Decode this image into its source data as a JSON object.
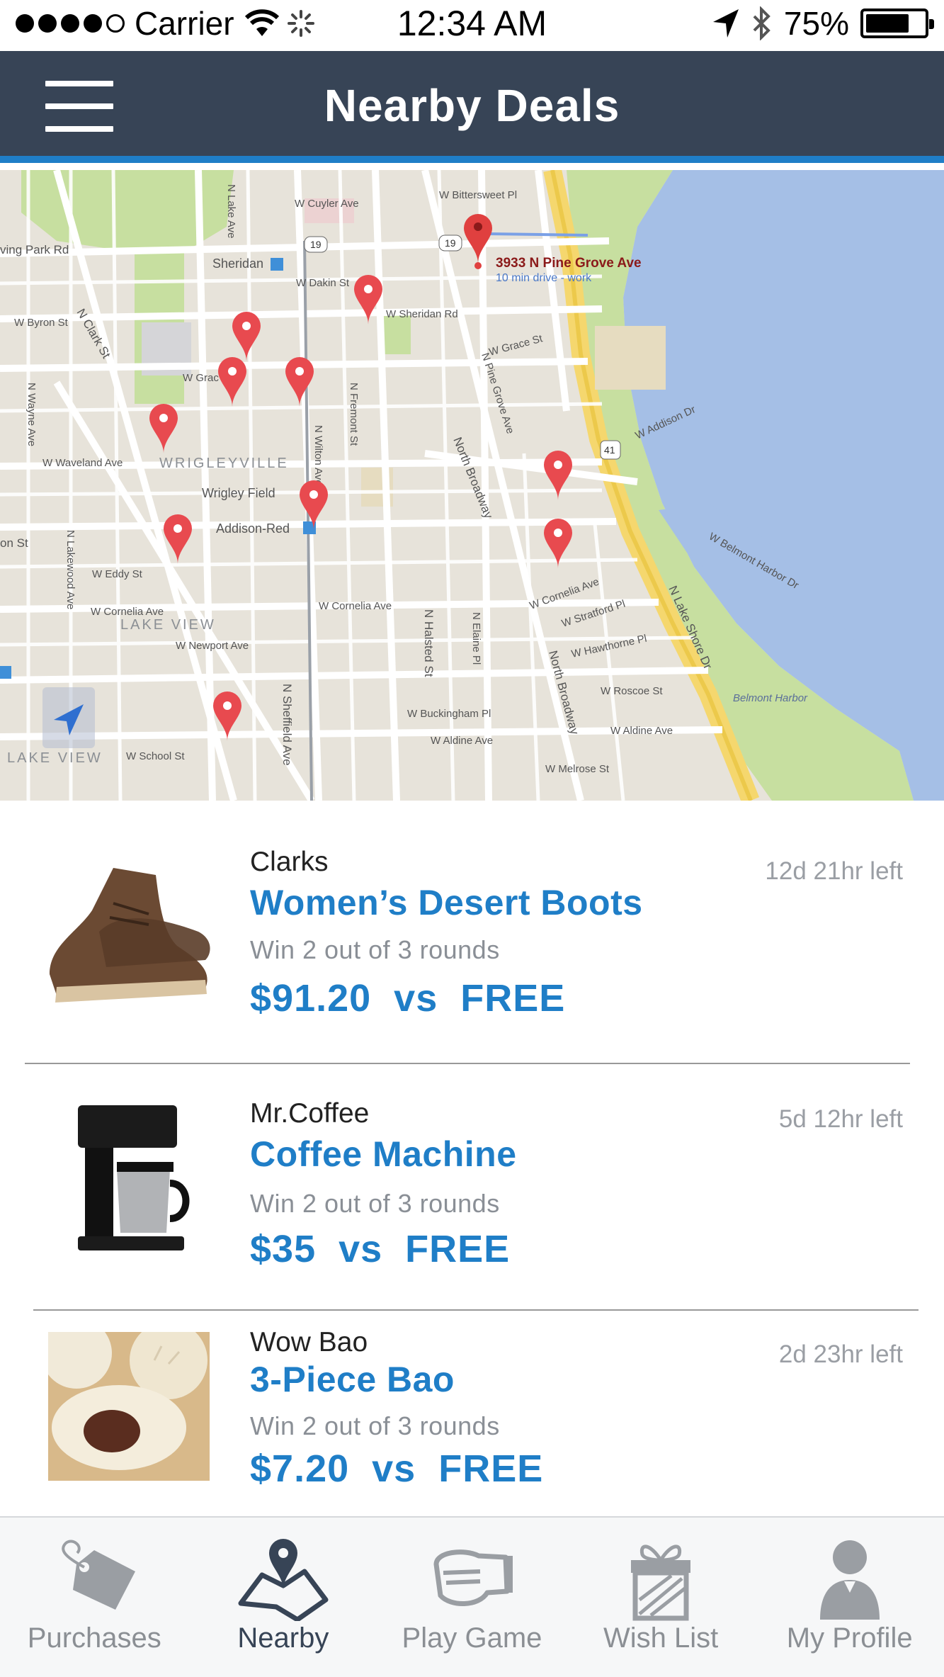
{
  "status_bar": {
    "carrier": "Carrier",
    "time": "12:34 AM",
    "battery": "75%",
    "battery_level": 0.75
  },
  "header": {
    "title": "Nearby Deals"
  },
  "map": {
    "location_label": "3933 N Pine Grove Ave",
    "location_sublabel": "10 min drive - work",
    "neighborhoods": [
      "WRIGLEYVILLE",
      "LAKE VIEW",
      "LAKE VIEW"
    ],
    "places": [
      "Sheridan",
      "Wrigley Field",
      "Addison-Red",
      "Belmont Harbor"
    ],
    "streets": [
      "W Cuyler Ave",
      "W Bittersweet Pl",
      "ving Park Rd",
      "W Dakin St",
      "W Sheridan Rd",
      "W Byron St",
      "N Clark St",
      "W Grace St",
      "N Wayne Ave",
      "W Waveland Ave",
      "N Fremont St",
      "N Wilton Ave",
      "North Broadway",
      "N Pine Grove Ave",
      "W Addison Dr",
      "W Eddy St",
      "N Lakewood Ave",
      "W Cornelia Ave",
      "W Newport Ave",
      "N Halsted St",
      "N Elaine Pl",
      "W Stratford Pl",
      "W Hawthorne Pl",
      "W Roscoe St",
      "W Buckingham Pl",
      "W Aldine Ave",
      "W Melrose St",
      "N Sheffield Ave",
      "W School St",
      "N Lake Shore Dr",
      "W Belmont Harbor Dr",
      "W Cornelia Ave",
      "W Aldine Ave",
      "on St",
      "W Gra",
      "W Byron St"
    ],
    "route_shields": [
      "19",
      "19",
      "41"
    ],
    "pin_color": "#e84a4f"
  },
  "deals": [
    {
      "brand": "Clarks",
      "title": "Women’s Desert Boots",
      "condition": "Win 2 out of 3 rounds",
      "price": "$91.20  vs  FREE",
      "time_left": "12d 21hr left",
      "image_icon": "desert-boots-image"
    },
    {
      "brand": "Mr.Coffee",
      "title": "Coffee Machine",
      "condition": "Win 2 out of 3 rounds",
      "price": "$35  vs  FREE",
      "time_left": "5d 12hr left",
      "image_icon": "coffee-machine-image"
    },
    {
      "brand": "Wow Bao",
      "title": "3-Piece Bao",
      "condition": "Win 2 out of 3 rounds",
      "price": "$7.20  vs  FREE",
      "time_left": "2d 23hr left",
      "image_icon": "bao-image"
    }
  ],
  "tabs": [
    {
      "label": "Purchases",
      "icon": "tag-icon",
      "active": false
    },
    {
      "label": "Nearby",
      "icon": "map-pin-icon",
      "active": true
    },
    {
      "label": "Play Game",
      "icon": "fist-icon",
      "active": false
    },
    {
      "label": "Wish List",
      "icon": "gift-icon",
      "active": false
    },
    {
      "label": "My Profile",
      "icon": "profile-icon",
      "active": false
    }
  ],
  "colors": {
    "header_bg": "#374456",
    "accent": "#1f7ec7",
    "pin": "#e84a4f",
    "water": "#a5bfe6",
    "park": "#c7dfa0"
  }
}
